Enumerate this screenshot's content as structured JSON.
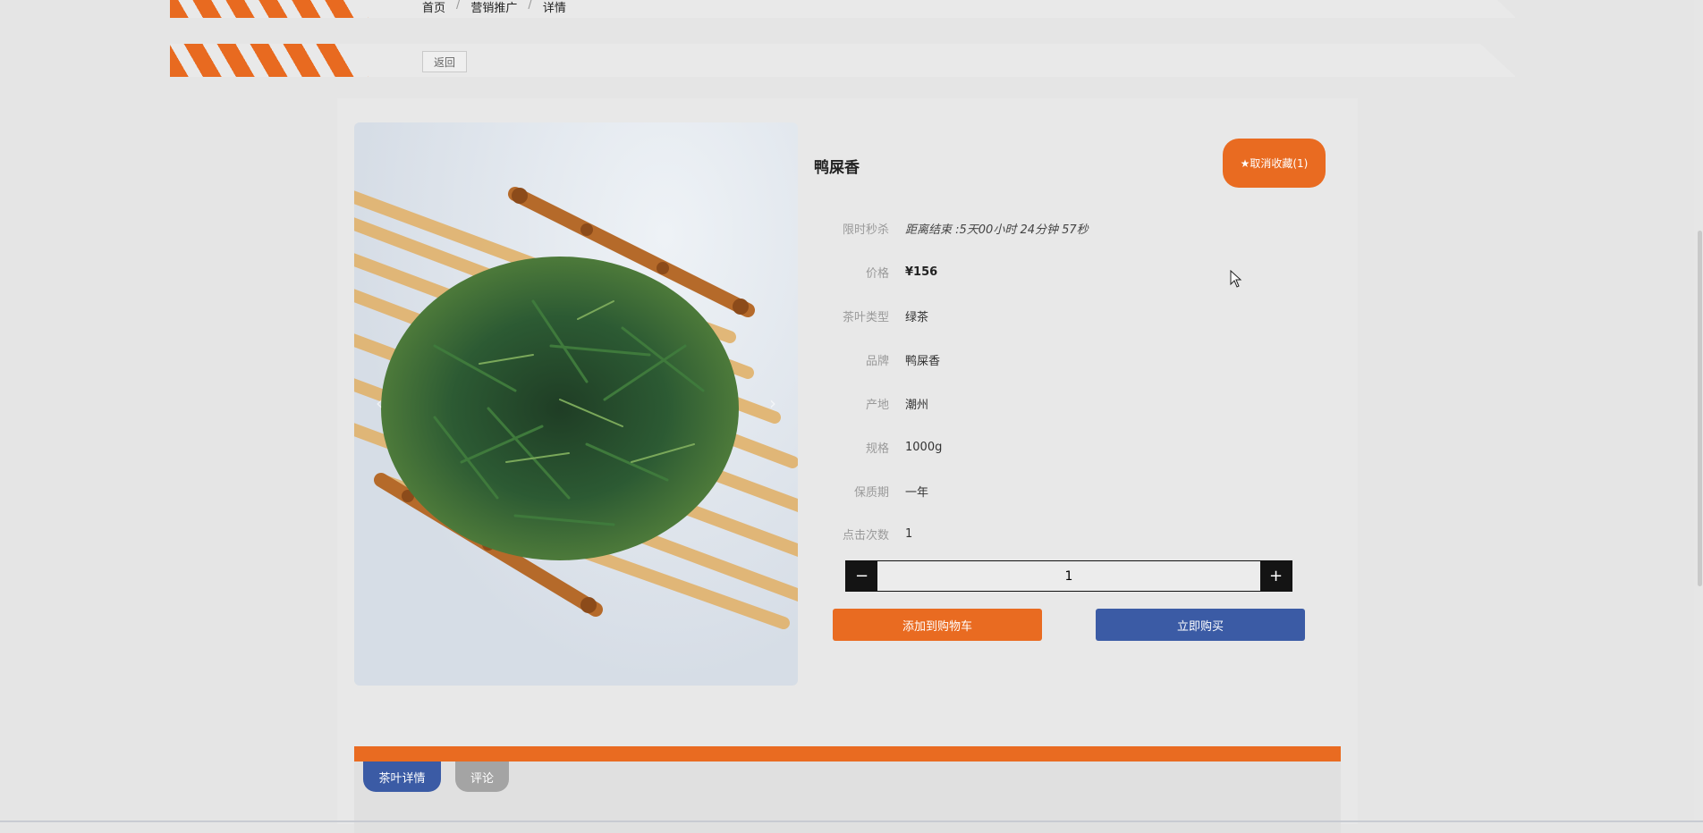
{
  "breadcrumb": {
    "items": [
      "首页",
      "营销推广",
      "详情"
    ],
    "separator": "/"
  },
  "toolbar": {
    "back_label": "返回"
  },
  "product": {
    "name": "鸭屎香",
    "favorite_label": "★取消收藏(1)",
    "fields": [
      {
        "label": "限时秒杀",
        "value": "距离结束 :5天00小时 24分钟 57秒"
      },
      {
        "label": "价格",
        "value": "¥156"
      },
      {
        "label": "茶叶类型",
        "value": "绿茶"
      },
      {
        "label": "品牌",
        "value": "鸭屎香"
      },
      {
        "label": "产地",
        "value": "潮州"
      },
      {
        "label": "规格",
        "value": "1000g"
      },
      {
        "label": "保质期",
        "value": "一年"
      },
      {
        "label": "点击次数",
        "value": "1"
      }
    ],
    "quantity": {
      "value": "1",
      "minus": "−",
      "plus": "+"
    },
    "add_to_cart_label": "添加到购物车",
    "buy_now_label": "立即购买"
  },
  "carousel": {
    "prev": "‹",
    "next": "›"
  },
  "tabs": [
    {
      "label": "茶叶详情",
      "active": true
    },
    {
      "label": "评论",
      "active": false
    }
  ],
  "colors": {
    "accent_orange": "#e96b21",
    "accent_blue": "#3b5ba5",
    "background": "#e5e5e5"
  }
}
